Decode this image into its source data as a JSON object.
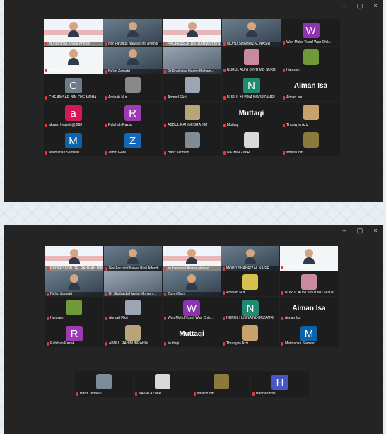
{
  "window_controls": {
    "minimize": "–",
    "maximize": "▢",
    "close": "×"
  },
  "colors": {
    "accent_green": "#1ea64a",
    "avatar_W": "#8c33b0",
    "avatar_C": "#6e7a88",
    "avatar_N": "#1f8a70",
    "avatar_a": "#d4185a",
    "avatar_R": "#9c3bb4",
    "avatar_M": "#0e62a8",
    "avatar_Z": "#1767b9",
    "avatar_H": "#4a56c8"
  },
  "screen1": {
    "tiles": [
      {
        "name": "Muhammad Anwar Ahmad",
        "kind": "slide"
      },
      {
        "name": "Nor Farzatul Najwa Binti Affendi",
        "kind": "cam"
      },
      {
        "name": "PROFESSOR DR. RAHMAH BINTI...",
        "kind": "slide"
      },
      {
        "name": "MOHD SHAHRIZAL NASIR",
        "kind": "cam"
      },
      {
        "name": "Wan Mohd Yusof Wan Chik...",
        "kind": "avatar",
        "letter": "W",
        "color": "#8c33b0"
      },
      {
        "name": "Jawhari Yazid",
        "kind": "csd"
      },
      {
        "name": "Na'im Zamatri",
        "kind": "cam"
      },
      {
        "name": "Dr Shuhaida Hanim Moham...",
        "kind": "photo"
      },
      {
        "name": "NURUL AUNI BINTI MD SUKRI",
        "kind": "thumb",
        "thumbcolor": "#c98aa0"
      },
      {
        "name": "Hanisah",
        "kind": "thumb",
        "thumbcolor": "#6e9a3c"
      },
      {
        "name": "CHE AMSAR BIN CHE MOHA...",
        "kind": "avatar",
        "letter": "C",
        "color": "#6e7a88"
      },
      {
        "name": "Aminah Nur",
        "kind": "thumb",
        "thumbcolor": "#888888"
      },
      {
        "name": "Ahmad Fikri",
        "kind": "thumb",
        "thumbcolor": "#9aa6b5"
      },
      {
        "name": "NURUL HUSNA NOORZAMRI",
        "kind": "avatar",
        "letter": "N",
        "color": "#1f8a70"
      },
      {
        "name": "Aiman Isa",
        "kind": "big",
        "big": "Aiman Isa"
      },
      {
        "name": "akzam Iwajishi@l290",
        "kind": "avatar",
        "letter": "a",
        "color": "#d4185a"
      },
      {
        "name": "Rabihah Razak",
        "kind": "avatar",
        "letter": "R",
        "color": "#9c3bb4"
      },
      {
        "name": "ABDUL RAHIM IBRAHIM",
        "kind": "thumb",
        "thumbcolor": "#b9a47a"
      },
      {
        "name": "Muttaqi",
        "kind": "big",
        "big": "Muttaqi"
      },
      {
        "name": "Thurayya Aziz",
        "kind": "thumb",
        "thumbcolor": "#c7a26c"
      },
      {
        "name": "Maimanah Samsuri",
        "kind": "avatar",
        "letter": "M",
        "color": "#0e62a8"
      },
      {
        "name": "Zamri Gani",
        "kind": "avatar",
        "letter": "Z",
        "color": "#1767b9"
      },
      {
        "name": "Hariz Termezi",
        "kind": "thumb",
        "thumbcolor": "#7d8c96"
      },
      {
        "name": "NAJMI AZWIR",
        "kind": "thumb",
        "thumbcolor": "#d9d9d9"
      },
      {
        "name": "whafizudin",
        "kind": "thumb",
        "thumbcolor": "#8a7a3c"
      }
    ]
  },
  "screen2": {
    "tiles": [
      {
        "name": "PROFESSOR DR. RAHMAH BINTI...",
        "kind": "slide"
      },
      {
        "name": "Nor Farzatul Najwa Binti Affendi",
        "kind": "cam"
      },
      {
        "name": "Muhammad Anwar Ahmad",
        "kind": "slide"
      },
      {
        "name": "MOHD SHAHRIZAL NASIR",
        "kind": "cam"
      },
      {
        "name": "Jawhari Yazid",
        "kind": "csd"
      },
      {
        "name": "Na'im Zamatri",
        "kind": "cam"
      },
      {
        "name": "Dr Shuhaida Hanim Moham...",
        "kind": "photo"
      },
      {
        "name": "Zamri Gani",
        "kind": "cam"
      },
      {
        "name": "Aminah Nur",
        "kind": "thumb",
        "thumbcolor": "#d6c24a"
      },
      {
        "name": "NURUL AUNI BINTI MD SUKRI",
        "kind": "thumb",
        "thumbcolor": "#c98aa0"
      },
      {
        "name": "Hanisah",
        "kind": "thumb",
        "thumbcolor": "#6e9a3c"
      },
      {
        "name": "Ahmad Fikri",
        "kind": "thumb",
        "thumbcolor": "#9aa6b5"
      },
      {
        "name": "Wan Mohd Yusof Wan Chik...",
        "kind": "avatar",
        "letter": "W",
        "color": "#8c33b0"
      },
      {
        "name": "NURUL HUSNA NOORZAMRI",
        "kind": "avatar",
        "letter": "N",
        "color": "#1f8a70"
      },
      {
        "name": "Aiman Isa",
        "kind": "big",
        "big": "Aiman Isa"
      },
      {
        "name": "Rabihah Razak",
        "kind": "avatar",
        "letter": "R",
        "color": "#9c3bb4"
      },
      {
        "name": "ABDUL RAHIM IBRAHIM",
        "kind": "thumb",
        "thumbcolor": "#b9a47a"
      },
      {
        "name": "Muttaqi",
        "kind": "big",
        "big": "Muttaqi"
      },
      {
        "name": "Thurayya Aziz",
        "kind": "thumb",
        "thumbcolor": "#c7a26c"
      },
      {
        "name": "Maimanah Samsuri",
        "kind": "avatar",
        "letter": "M",
        "color": "#0e62a8"
      }
    ],
    "tiles_row5": [
      {
        "name": "Hariz Termezi",
        "kind": "thumb",
        "thumbcolor": "#7d8c96"
      },
      {
        "name": "NAJMI AZWIR",
        "kind": "thumb",
        "thumbcolor": "#d9d9d9"
      },
      {
        "name": "whafizudin",
        "kind": "thumb",
        "thumbcolor": "#8a7a3c"
      },
      {
        "name": "Hannah Hiril",
        "kind": "avatar",
        "letter": "H",
        "color": "#4a56c8"
      }
    ]
  }
}
